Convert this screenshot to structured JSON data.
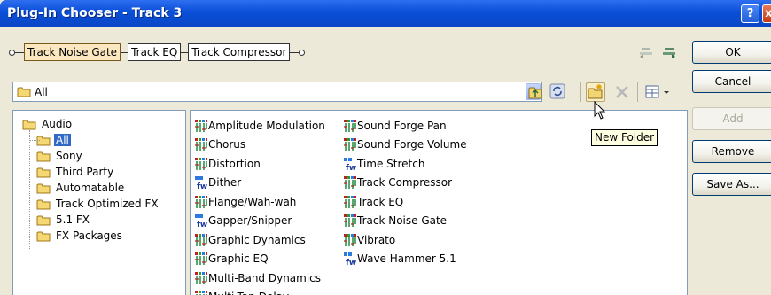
{
  "window": {
    "title": "Plug-In Chooser - Track 3",
    "help_label": "?",
    "close_label": "x"
  },
  "chain": {
    "plugins": [
      "Track Noise Gate",
      "Track EQ",
      "Track Compressor"
    ],
    "active_index": 0
  },
  "buttons": {
    "ok": "OK",
    "cancel": "Cancel",
    "add": "Add",
    "remove": "Remove",
    "save_as": "Save As..."
  },
  "path_combo": {
    "value": "All"
  },
  "tooltip": {
    "text": "New Folder"
  },
  "tree": {
    "root": "Audio",
    "children": [
      "All",
      "Sony",
      "Third Party",
      "Automatable",
      "Track Optimized FX",
      "5.1 FX",
      "FX Packages"
    ],
    "selected": "All"
  },
  "plugins": {
    "column1": [
      {
        "name": "Amplitude Modulation",
        "icon": "multi-plug-icon"
      },
      {
        "name": "Chorus",
        "icon": "multi-plug-icon"
      },
      {
        "name": "Distortion",
        "icon": "multi-plug-icon"
      },
      {
        "name": "Dither",
        "icon": "fw-plug-icon"
      },
      {
        "name": "Flange/Wah-wah",
        "icon": "multi-plug-icon"
      },
      {
        "name": "Gapper/Snipper",
        "icon": "fw-plug-icon"
      },
      {
        "name": "Graphic Dynamics",
        "icon": "multi-plug-icon"
      },
      {
        "name": "Graphic EQ",
        "icon": "multi-plug-icon"
      },
      {
        "name": "Multi-Band Dynamics",
        "icon": "multi-plug-icon"
      },
      {
        "name": "Multi-Tap Delay",
        "icon": "multi-plug-icon"
      }
    ],
    "column2": [
      {
        "name": "Sound Forge Pan",
        "icon": "multi-plug-icon"
      },
      {
        "name": "Sound Forge Volume",
        "icon": "multi-plug-icon"
      },
      {
        "name": "Time Stretch",
        "icon": "fw-plug-icon"
      },
      {
        "name": "Track Compressor",
        "icon": "multi-plug-icon"
      },
      {
        "name": "Track EQ",
        "icon": "multi-plug-icon"
      },
      {
        "name": "Track Noise Gate",
        "icon": "multi-plug-icon"
      },
      {
        "name": "Vibrato",
        "icon": "multi-plug-icon"
      },
      {
        "name": "Wave Hammer 5.1",
        "icon": "fw-plug-icon"
      }
    ]
  },
  "colors": {
    "titlebar": "#0a4fd8",
    "selection": "#316ac5",
    "tooltip_bg": "#ffffe1"
  }
}
